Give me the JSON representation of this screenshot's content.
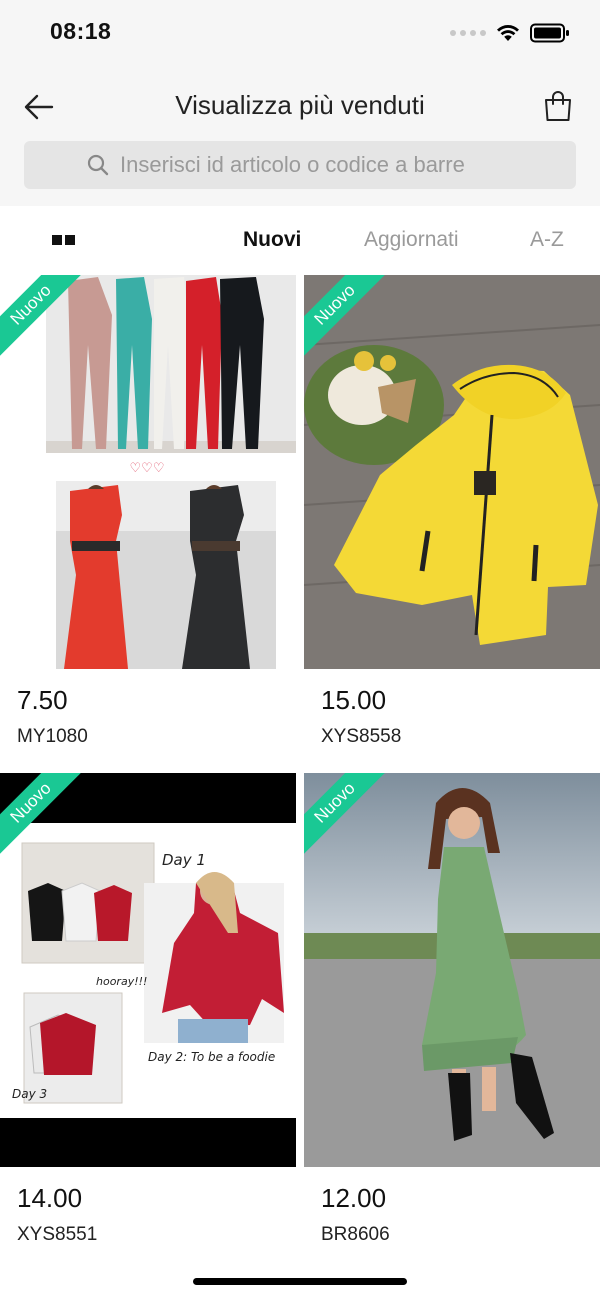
{
  "status_bar": {
    "time": "08:18"
  },
  "header": {
    "title": "Visualizza più venduti"
  },
  "search": {
    "placeholder": "Inserisci id articolo o codice a barre"
  },
  "sort": {
    "tabs": [
      "Nuovi",
      "Aggiornati",
      "A-Z"
    ],
    "active": "Nuovi"
  },
  "products": [
    {
      "badge": "Nuovo",
      "price": "7.50",
      "code": "MY1080",
      "image_text": "♡♡♡"
    },
    {
      "badge": "Nuovo",
      "price": "15.00",
      "code": "XYS8558"
    },
    {
      "badge": "Nuovo",
      "price": "14.00",
      "code": "XYS8551",
      "image_text": {
        "day1": "Day 1",
        "hooray": "hooray!!!",
        "day2": "Day 2: To be a foodie",
        "day3": "Day 3"
      }
    },
    {
      "badge": "Nuovo",
      "price": "12.00",
      "code": "BR8606"
    }
  ],
  "colors": {
    "badge_green": "#1ac894",
    "tab_active": "#111111",
    "tab_inactive": "#9a9a9a"
  },
  "icons": [
    "wifi-icon",
    "battery-icon",
    "back-arrow-icon",
    "shopping-bag-icon",
    "search-icon",
    "grid-view-icon"
  ]
}
